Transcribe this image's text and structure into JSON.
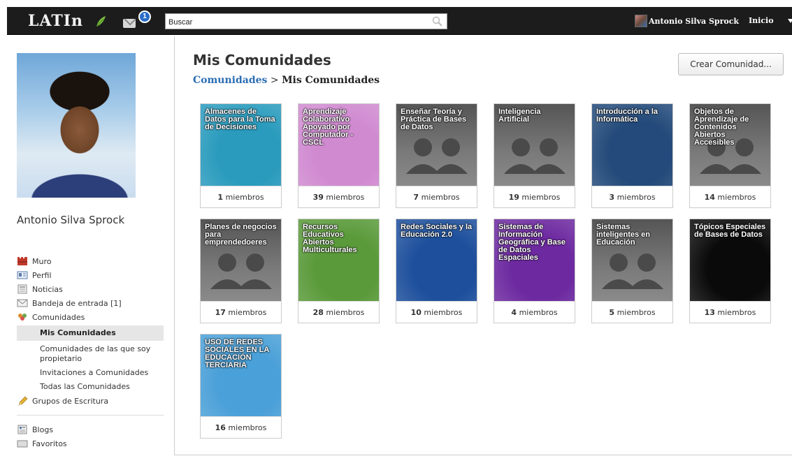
{
  "app": {
    "logo": "LATIn",
    "notifications": "1"
  },
  "search": {
    "placeholder": "Buscar"
  },
  "user": {
    "name": "Antonio Silva Sprock"
  },
  "topnav": {
    "home": "Inicio"
  },
  "profile": {
    "name": "Antonio Silva Sprock"
  },
  "sidebar": {
    "items": [
      {
        "label": "Muro",
        "icon": "wall-icon"
      },
      {
        "label": "Perfil",
        "icon": "profile-card-icon"
      },
      {
        "label": "Noticias",
        "icon": "news-icon"
      },
      {
        "label": "Bandeja de entrada [1]",
        "icon": "inbox-icon"
      },
      {
        "label": "Comunidades",
        "icon": "communities-icon"
      }
    ],
    "sub_items": [
      {
        "label": "Mis Comunidades",
        "active": true
      },
      {
        "label": "Comunidades de las que soy propietario"
      },
      {
        "label": "Invitaciones a Comunidades"
      },
      {
        "label": "Todas las Comunidades"
      }
    ],
    "writing_groups": {
      "label": "Grupos de Escritura",
      "icon": "pencil-icon"
    },
    "blogs": {
      "label": "Blogs",
      "icon": "blog-icon"
    },
    "favorites": {
      "label": "Favoritos",
      "icon": "favorites-icon"
    }
  },
  "main": {
    "title": "Mis Comunidades",
    "breadcrumb": {
      "link": "Comunidades",
      "separator": ">",
      "current": "Mis Comunidades"
    },
    "create_button": "Crear Comunidad...",
    "members_label": "miembros"
  },
  "communities": [
    {
      "name": "Almacenes de Datos para la Toma de Decisiones",
      "count": "1",
      "bg": "#2a9bbd"
    },
    {
      "name": "Aprendizaje Colaborativo Apoyado por Computador - CSCL",
      "count": "39",
      "bg": "#d08ad0"
    },
    {
      "name": "Enseñar Teoría y Práctica de Bases de Datos",
      "count": "7",
      "bg": "#6d6d6d"
    },
    {
      "name": "Inteligencia Artificial",
      "count": "19",
      "bg": "#6d6d6d"
    },
    {
      "name": "Introducción a la Informática",
      "count": "3",
      "bg": "#234a7a"
    },
    {
      "name": "Objetos de Aprendizaje de Contenidos Abiertos Accesibles",
      "count": "14",
      "bg": "#6d6d6d"
    },
    {
      "name": "Planes de negocios para emprendedoeres",
      "count": "17",
      "bg": "#6d6d6d"
    },
    {
      "name": "Recursos Educativos Abiertos Multiculturales",
      "count": "28",
      "bg": "#5a9a3a"
    },
    {
      "name": "Redes Sociales y la Educación 2.0",
      "count": "10",
      "bg": "#1d4f9c"
    },
    {
      "name": "Sistemas de Información Geográfica y Base de Datos Espaciales",
      "count": "4",
      "bg": "#6d2aa0"
    },
    {
      "name": "Sistemas inteligentes en Educación",
      "count": "5",
      "bg": "#6d6d6d"
    },
    {
      "name": "Tópicos Especiales de Bases de Datos",
      "count": "13",
      "bg": "#0a0a0a"
    },
    {
      "name": "USO DE REDES SOCIALES EN LA EDUCACIÓN TERCIARIA",
      "count": "16",
      "bg": "#4aa0d8"
    }
  ]
}
